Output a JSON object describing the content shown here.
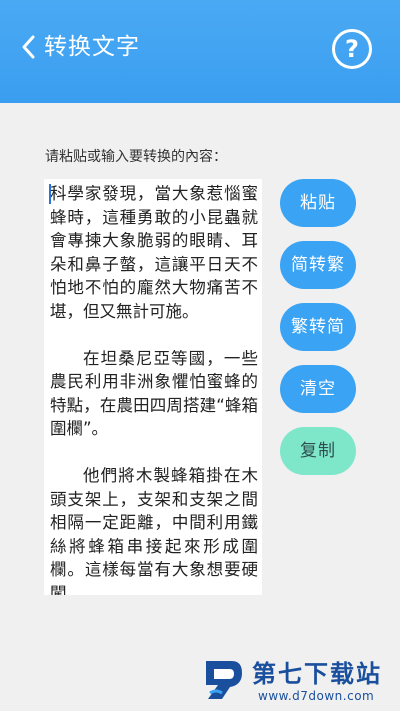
{
  "header": {
    "title": "转换文字",
    "help_icon": "?"
  },
  "prompt": "请粘贴或输入要转换的內容：",
  "text_content": {
    "paragraphs": [
      "科學家發現，當大象惹惱蜜蜂時，這種勇敢的小昆蟲就會專揀大象脆弱的眼睛、耳朵和鼻子螫，這讓平日天不怕地不怕的龐然大物痛苦不堪，但又無計可施。",
      "在坦桑尼亞等國，一些農民利用非洲象懼怕蜜蜂的特點，在農田四周搭建“蜂箱圍欄”。",
      "他們將木製蜂箱掛在木頭支架上，支架和支架之間相隔一定距離，中間利用鐵絲將蜂箱串接起來形成圍欄。這樣每當有大象想要硬闖"
    ]
  },
  "buttons": {
    "paste": "粘贴",
    "to_traditional": "简转繁",
    "to_simplified": "繁转简",
    "clear": "清空",
    "copy": "复制"
  },
  "watermark": {
    "title": "第七下载站",
    "url": "www.d7down.com"
  },
  "colors": {
    "header": "#3ea3f2",
    "button": "#3aa3f3",
    "copy_button": "#7ee6c9",
    "logo": "#1a4f9e"
  }
}
